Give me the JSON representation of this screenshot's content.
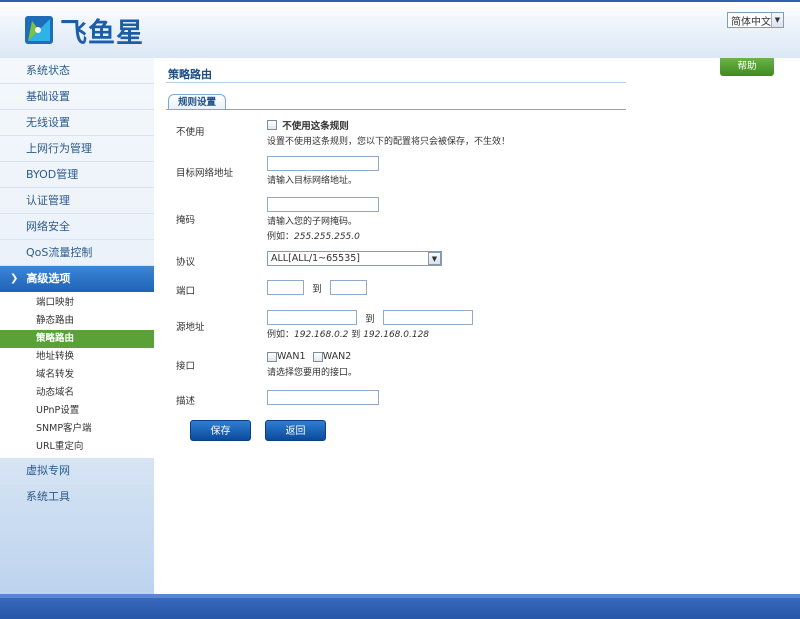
{
  "brand": {
    "logo_text": "飞鱼星"
  },
  "language": {
    "selected": "简体中文"
  },
  "sidebar": {
    "items_top": [
      {
        "label": "系统状态"
      },
      {
        "label": "基础设置"
      },
      {
        "label": "无线设置"
      },
      {
        "label": "上网行为管理"
      },
      {
        "label": "BYOD管理"
      },
      {
        "label": "认证管理"
      },
      {
        "label": "网络安全"
      },
      {
        "label": "QoS流量控制"
      }
    ],
    "active_section": "高级选项",
    "sub_items": [
      {
        "label": "端口映射"
      },
      {
        "label": "静态路由"
      },
      {
        "label": "策略路由"
      },
      {
        "label": "地址转换"
      },
      {
        "label": "域名转发"
      },
      {
        "label": "动态域名"
      },
      {
        "label": "UPnP设置"
      },
      {
        "label": "SNMP客户端"
      },
      {
        "label": "URL重定向"
      }
    ],
    "items_bottom": [
      {
        "label": "虚拟专网"
      },
      {
        "label": "系统工具"
      }
    ]
  },
  "page": {
    "title": "策略路由",
    "help_label": "帮助",
    "tab_label": "规则设置"
  },
  "form": {
    "disable": {
      "label": "不使用",
      "checkbox_label": "不使用这条规则",
      "hint": "设置不使用这条规则，您以下的配置将只会被保存，不生效！"
    },
    "dest": {
      "label": "目标网络地址",
      "value": "",
      "hint": "请输入目标网络地址。"
    },
    "mask": {
      "label": "掩码",
      "value": "",
      "hint": "请输入您的子网掩码。",
      "example_prefix": "例如：",
      "example": "255.255.255.0"
    },
    "protocol": {
      "label": "协议",
      "selected": "ALL[ALL/1~65535]"
    },
    "port": {
      "label": "端口",
      "from": "",
      "to_label": "到",
      "to": ""
    },
    "src": {
      "label": "源地址",
      "from": "",
      "to_label": "到",
      "to": "",
      "example_prefix": "例如：",
      "example_from": "192.168.0.2",
      "example_mid": "到",
      "example_to": "192.168.0.128"
    },
    "iface": {
      "label": "接口",
      "wan1": "WAN1",
      "wan2": "WAN2",
      "hint": "请选择您要用的接口。"
    },
    "desc": {
      "label": "描述",
      "value": ""
    },
    "save_label": "保存",
    "back_label": "返回"
  }
}
